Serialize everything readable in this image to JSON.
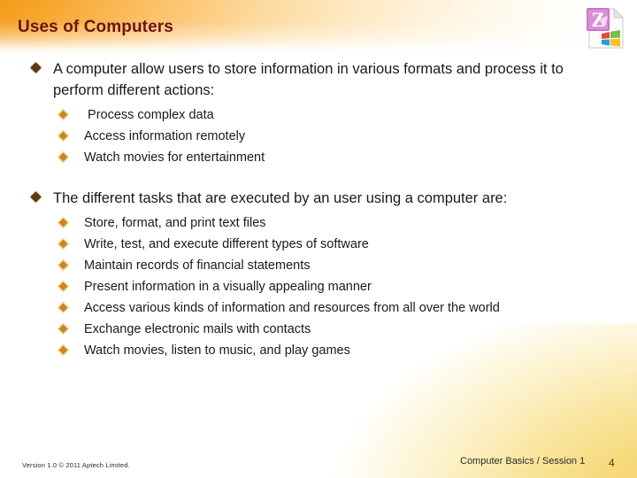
{
  "slide": {
    "title": "Uses of Computers",
    "title_color": "#6b1414",
    "accent_color": "#f59b16",
    "corner_color": "#f3cf63"
  },
  "logo": {
    "icon": "zip-file-icon",
    "letter": "Z"
  },
  "blocks": [
    {
      "bullet_icon": "diamond-bullet-icon",
      "text": "A computer allow users to store information in various formats and process it to perform different actions:",
      "sub_items": [
        {
          "bullet_icon": "diamond-sub-bullet-icon",
          "text": " Process complex data"
        },
        {
          "bullet_icon": "diamond-sub-bullet-icon",
          "text": "Access information remotely"
        },
        {
          "bullet_icon": "diamond-sub-bullet-icon",
          "text": "Watch movies for entertainment"
        }
      ]
    },
    {
      "bullet_icon": "diamond-bullet-icon",
      "text": "The different tasks that are executed by an user using a computer are:",
      "sub_items": [
        {
          "bullet_icon": "diamond-sub-bullet-icon",
          "text": "Store, format, and print text files"
        },
        {
          "bullet_icon": "diamond-sub-bullet-icon",
          "text": "Write, test, and execute different types of software"
        },
        {
          "bullet_icon": "diamond-sub-bullet-icon",
          "text": "Maintain records of financial statements"
        },
        {
          "bullet_icon": "diamond-sub-bullet-icon",
          "text": "Present information in a visually appealing manner"
        },
        {
          "bullet_icon": "diamond-sub-bullet-icon",
          "text": "Access various kinds of information and resources from all over the world"
        },
        {
          "bullet_icon": "diamond-sub-bullet-icon",
          "text": "Exchange electronic mails with contacts"
        },
        {
          "bullet_icon": "diamond-sub-bullet-icon",
          "text": "Watch movies, listen to music, and play games"
        }
      ]
    }
  ],
  "footer": {
    "version": "Version 1.0 © 2011 Aptech Limited.",
    "course": "Computer Basics / Session 1",
    "page_number": "4"
  }
}
